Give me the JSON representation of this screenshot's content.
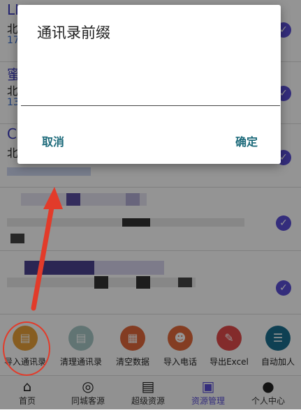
{
  "dialog": {
    "title": "通讯录前缀",
    "input_value": "",
    "cancel_label": "取消",
    "confirm_label": "确定"
  },
  "list": [
    {
      "title": "LI",
      "sub": "北",
      "phone": "17"
    },
    {
      "title": "蜜",
      "sub": "北",
      "phone": "13"
    },
    {
      "title": "CI",
      "sub": "北",
      "phone": ""
    }
  ],
  "toolbar": [
    {
      "label": "导入通讯录",
      "icon": "import-contacts-icon",
      "color": "#e8a13a"
    },
    {
      "label": "清理通讯录",
      "icon": "clean-contacts-icon",
      "color": "#a8c9c7"
    },
    {
      "label": "清空数据",
      "icon": "clear-data-icon",
      "color": "#e2683c"
    },
    {
      "label": "导入电话",
      "icon": "import-phone-icon",
      "color": "#e36a3c"
    },
    {
      "label": "导出Excel",
      "icon": "export-excel-icon",
      "color": "#e24b4b"
    },
    {
      "label": "自动加人",
      "icon": "auto-add-icon",
      "color": "#1b6f8f"
    }
  ],
  "tabs": [
    {
      "label": "首页",
      "icon": "home-icon",
      "active": false
    },
    {
      "label": "同城客源",
      "icon": "chat-icon",
      "active": false
    },
    {
      "label": "超级资源",
      "icon": "database-icon",
      "active": false
    },
    {
      "label": "资源管理",
      "icon": "briefcase-icon",
      "active": true
    },
    {
      "label": "个人中心",
      "icon": "person-icon",
      "active": false
    }
  ],
  "colors": {
    "accent": "#5b4fd6",
    "dialog_button": "#1c6a7a",
    "annotation": "#e23b2a"
  }
}
